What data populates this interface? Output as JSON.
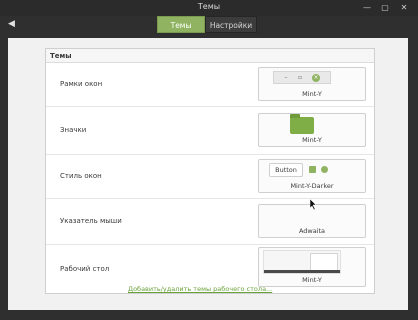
{
  "window": {
    "title": "Темы"
  },
  "toolbar": {
    "back_icon": "back-arrow-icon"
  },
  "tabs": [
    {
      "label": "Темы",
      "active": true
    },
    {
      "label": "Настройки",
      "active": false
    }
  ],
  "section": {
    "title": "Темы"
  },
  "rows": [
    {
      "label": "Рамки окон",
      "preview": "Mint-Y"
    },
    {
      "label": "Значки",
      "preview": "Mint-Y"
    },
    {
      "label": "Стиль окон",
      "preview": "Mint-Y-Darker",
      "button_text": "Button"
    },
    {
      "label": "Указатель мыши",
      "preview": "Adwaita"
    },
    {
      "label": "Рабочий стол",
      "preview": "Mint-Y"
    }
  ],
  "link": {
    "text": "Добавить/удалить темы рабочего стола..."
  },
  "colors": {
    "accent": "#8fb360",
    "link": "#6aa13a",
    "folder": "#7fae46"
  }
}
